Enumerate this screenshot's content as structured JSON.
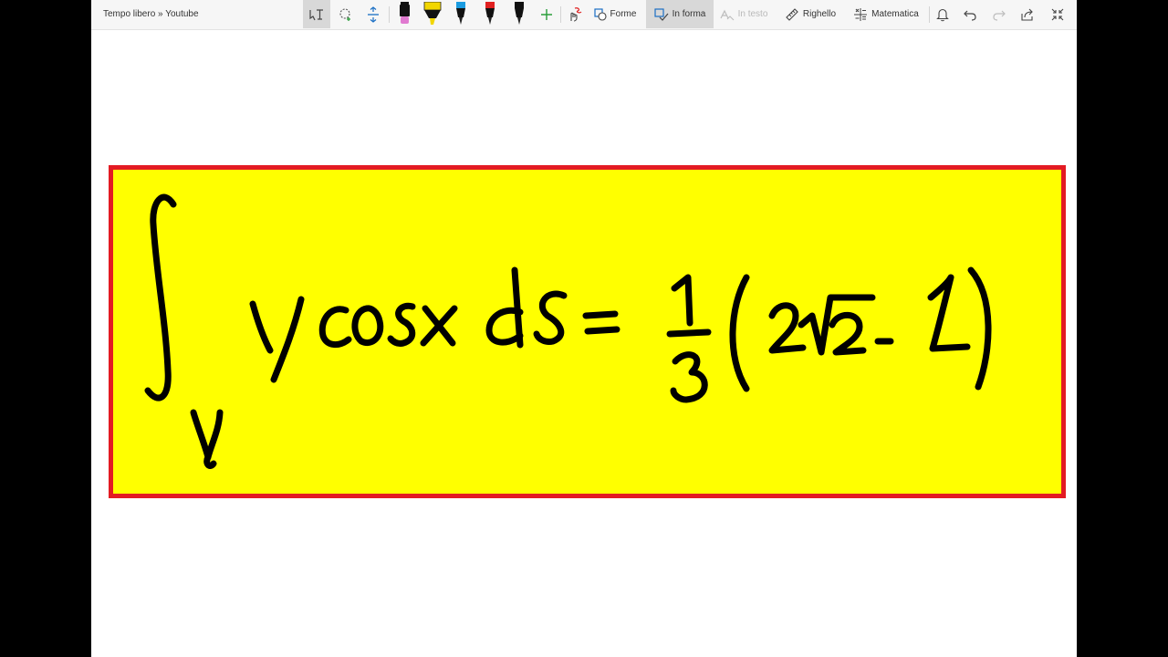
{
  "window": {
    "title": "Tempo libero » Youtube"
  },
  "toolbar": {
    "forme_label": "Forme",
    "in_forma_label": "In forma",
    "in_testo_label": "In testo",
    "righello_label": "Righello",
    "matematica_label": "Matematica"
  },
  "pens": [
    {
      "name": "pen-black-pink",
      "color": "#111111",
      "tip": "#e07ad0"
    },
    {
      "name": "highlighter-yellow",
      "color": "#f2d600",
      "tip": "#f2d600"
    },
    {
      "name": "pen-blue",
      "color": "#111111",
      "tip": "#1a9be0"
    },
    {
      "name": "pen-red",
      "color": "#111111",
      "tip": "#e02020"
    },
    {
      "name": "pen-black",
      "color": "#111111",
      "tip": "#111111"
    }
  ],
  "colors": {
    "note_background": "#ffff00",
    "note_border": "#e31b23",
    "ink": "#000000"
  },
  "handwritten_formula": "∫γ y cos x ds = 1/3 (2√2 − 1)"
}
